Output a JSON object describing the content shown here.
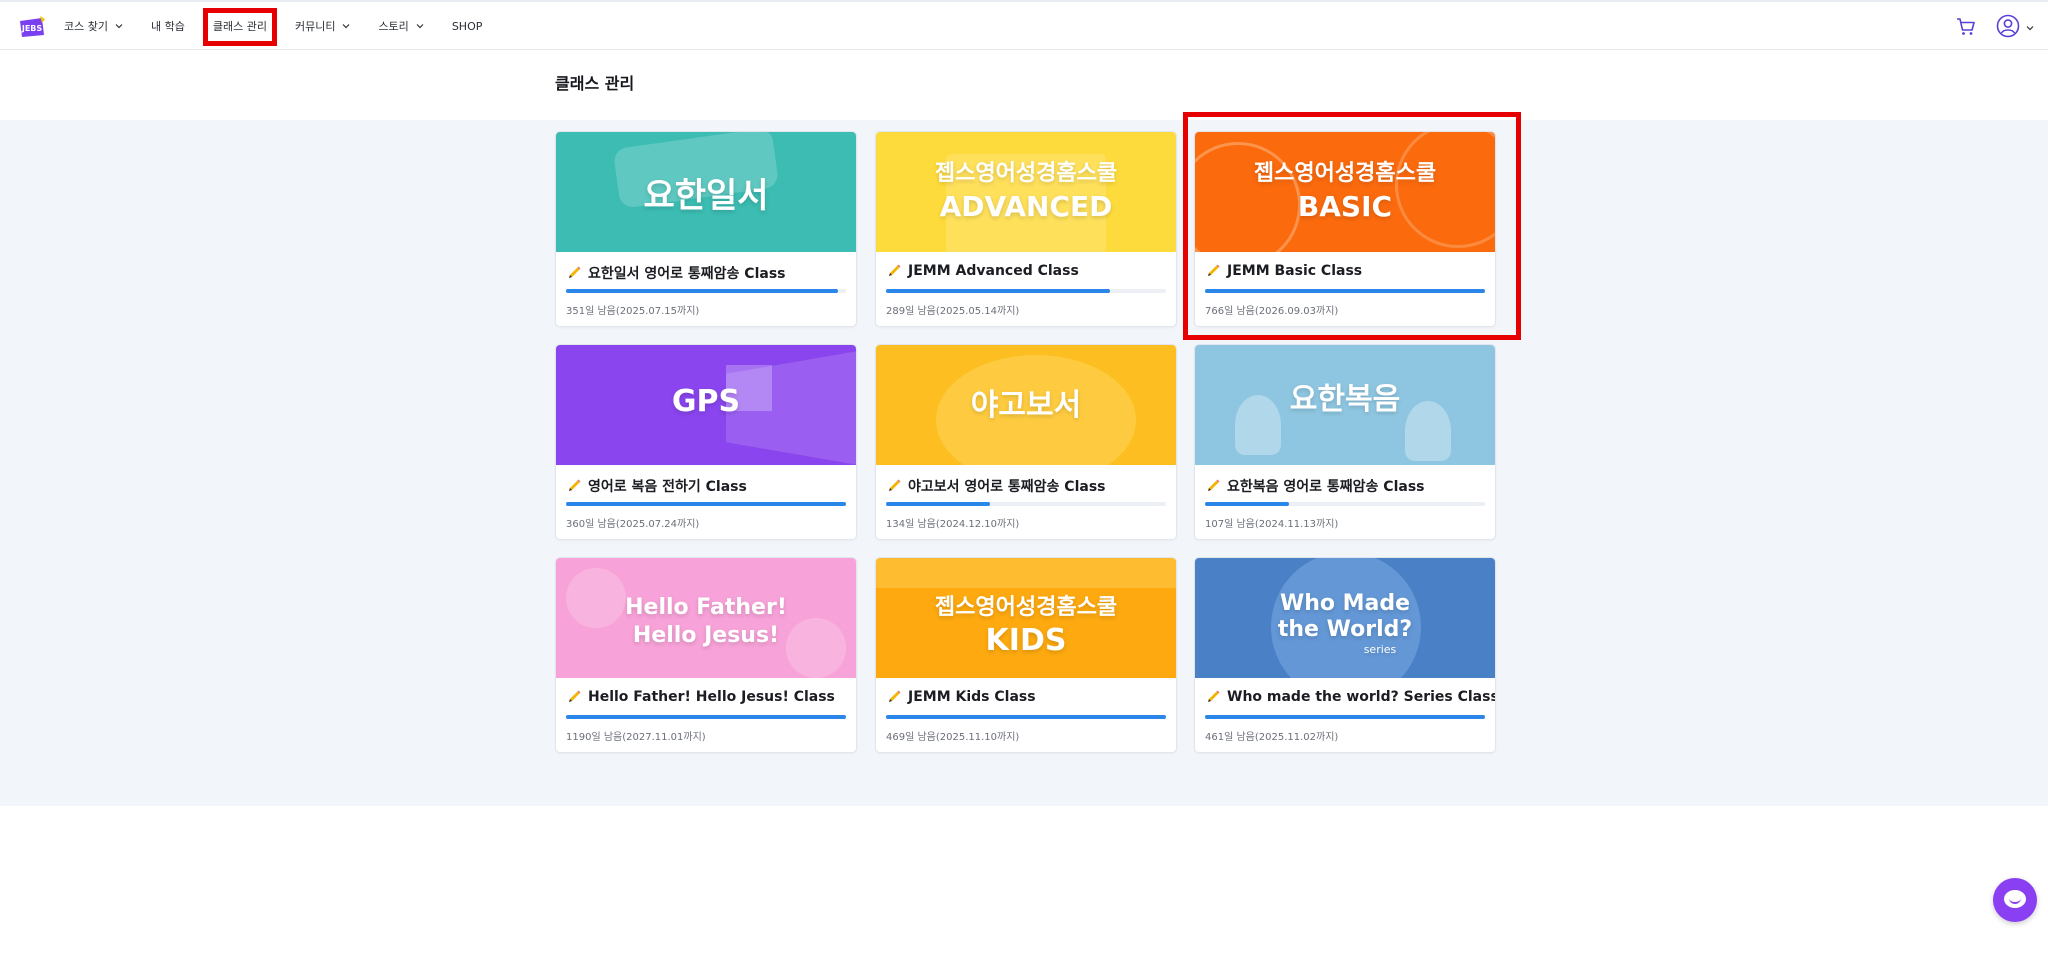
{
  "nav": {
    "logo_text": "JEBS",
    "items": [
      {
        "label": "코스 찾기",
        "dropdown": true
      },
      {
        "label": "내 학습",
        "dropdown": false
      },
      {
        "label": "클래스 관리",
        "dropdown": false,
        "active": true
      },
      {
        "label": "커뮤니티",
        "dropdown": true
      },
      {
        "label": "스토리",
        "dropdown": true
      },
      {
        "label": "SHOP",
        "dropdown": false
      }
    ]
  },
  "page": {
    "title": "클래스 관리"
  },
  "cards": [
    {
      "thumb_line1": "요한일서",
      "thumb_line2": "",
      "thumb_bg": "#3cbcb2",
      "title": "요한일서 영어로 통째암송 Class",
      "progress": 0.97,
      "remaining": "351일 남음(2025.07.15까지)"
    },
    {
      "thumb_line1": "젭스영어성경홈스쿨",
      "thumb_line2": "ADVANCED",
      "thumb_bg": "#fedb3c",
      "title": "JEMM Advanced Class",
      "progress": 0.8,
      "remaining": "289일 남음(2025.05.14까지)"
    },
    {
      "thumb_line1": "젭스영어성경홈스쿨",
      "thumb_line2": "BASIC",
      "thumb_bg": "#fb6a0d",
      "title": "JEMM Basic Class",
      "progress": 1.0,
      "remaining": "766일 남음(2026.09.03까지)"
    },
    {
      "thumb_line1": "GPS",
      "thumb_line2": "",
      "thumb_bg": "#8a45ee",
      "title": "영어로 복음 전하기 Class",
      "progress": 1.0,
      "remaining": "360일 남음(2025.07.24까지)"
    },
    {
      "thumb_line1": "야고보서",
      "thumb_line2": "",
      "thumb_bg": "#fdbe22",
      "title": "야고보서 영어로 통째암송 Class",
      "progress": 0.37,
      "remaining": "134일 남음(2024.12.10까지)"
    },
    {
      "thumb_line1": "요한복음",
      "thumb_line2": "",
      "thumb_bg": "#8ec6e1",
      "title": "요한복음 영어로 통째암송 Class",
      "progress": 0.3,
      "remaining": "107일 남음(2024.11.13까지)"
    },
    {
      "thumb_line1": "Hello Father!",
      "thumb_line2": "Hello Jesus!",
      "thumb_bg": "#f7a2d8",
      "title": "Hello Father! Hello Jesus! Class",
      "progress": 1.0,
      "remaining": "1190일 남음(2027.11.01까지)"
    },
    {
      "thumb_line1": "젭스영어성경홈스쿨",
      "thumb_line2": "KIDS",
      "thumb_bg": "#fda90f",
      "title": "JEMM Kids Class",
      "progress": 1.0,
      "remaining": "469일 남음(2025.11.10까지)"
    },
    {
      "thumb_line1": "Who Made",
      "thumb_line2": "the World?",
      "thumb_line3": "series",
      "thumb_bg": "#4a80c6",
      "title": "Who made the world? Series Class",
      "progress": 1.0,
      "remaining": "461일 남음(2025.11.02까지)"
    }
  ],
  "icons": {
    "cart": "cart-icon",
    "user": "user-icon",
    "chat": "chat-icon",
    "pencil": "pencil-icon"
  },
  "colors": {
    "accent": "#2a86e8",
    "highlight": "#e60000",
    "chat": "#8a3ff2"
  }
}
